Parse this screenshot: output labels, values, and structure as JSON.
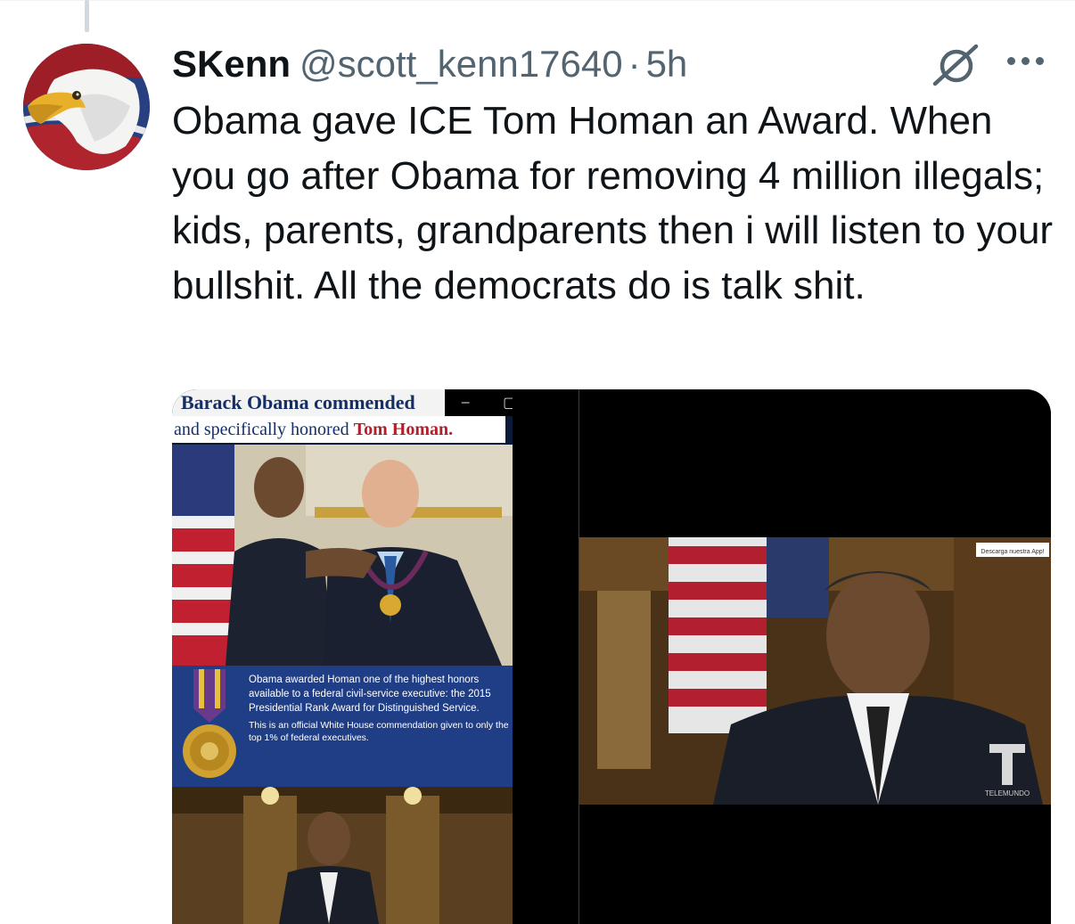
{
  "tweet": {
    "author_name": "SKenn",
    "handle": "@scott_kenn17640",
    "separator": "·",
    "time": "5h",
    "text": "Obama gave ICE Tom Homan an Award. When you go after Obama for removing 4 million illegals; kids, parents, grandparents then i will listen to your bullshit. All the democrats do is talk shit."
  },
  "icons": {
    "grok": "grok-icon",
    "more": "more-options-icon",
    "avatar": "eagle-avatar"
  },
  "media": {
    "banner_title": "Barack Obama commended",
    "banner_sub_prefix": "and specifically honored ",
    "banner_sub_highlight": "Tom Homan.",
    "window_minimize": "–",
    "window_maximize": "▢",
    "window_close": "✕",
    "info_line1": "Obama awarded Homan one of the highest honors available to a federal civil-service executive: the 2015 Presidential Rank Award for Distinguished Service.",
    "info_line2": "This is an official White House commendation given to only the top 1% of federal executives.",
    "tv_badge": "Descarga nuestra App!",
    "tv_logo": "TELEMUNDO"
  },
  "colors": {
    "text_primary": "#0f1419",
    "text_secondary": "#536471",
    "banner_blue": "#142f68",
    "highlight_red": "#b21e2a",
    "info_bg": "#203e86"
  }
}
